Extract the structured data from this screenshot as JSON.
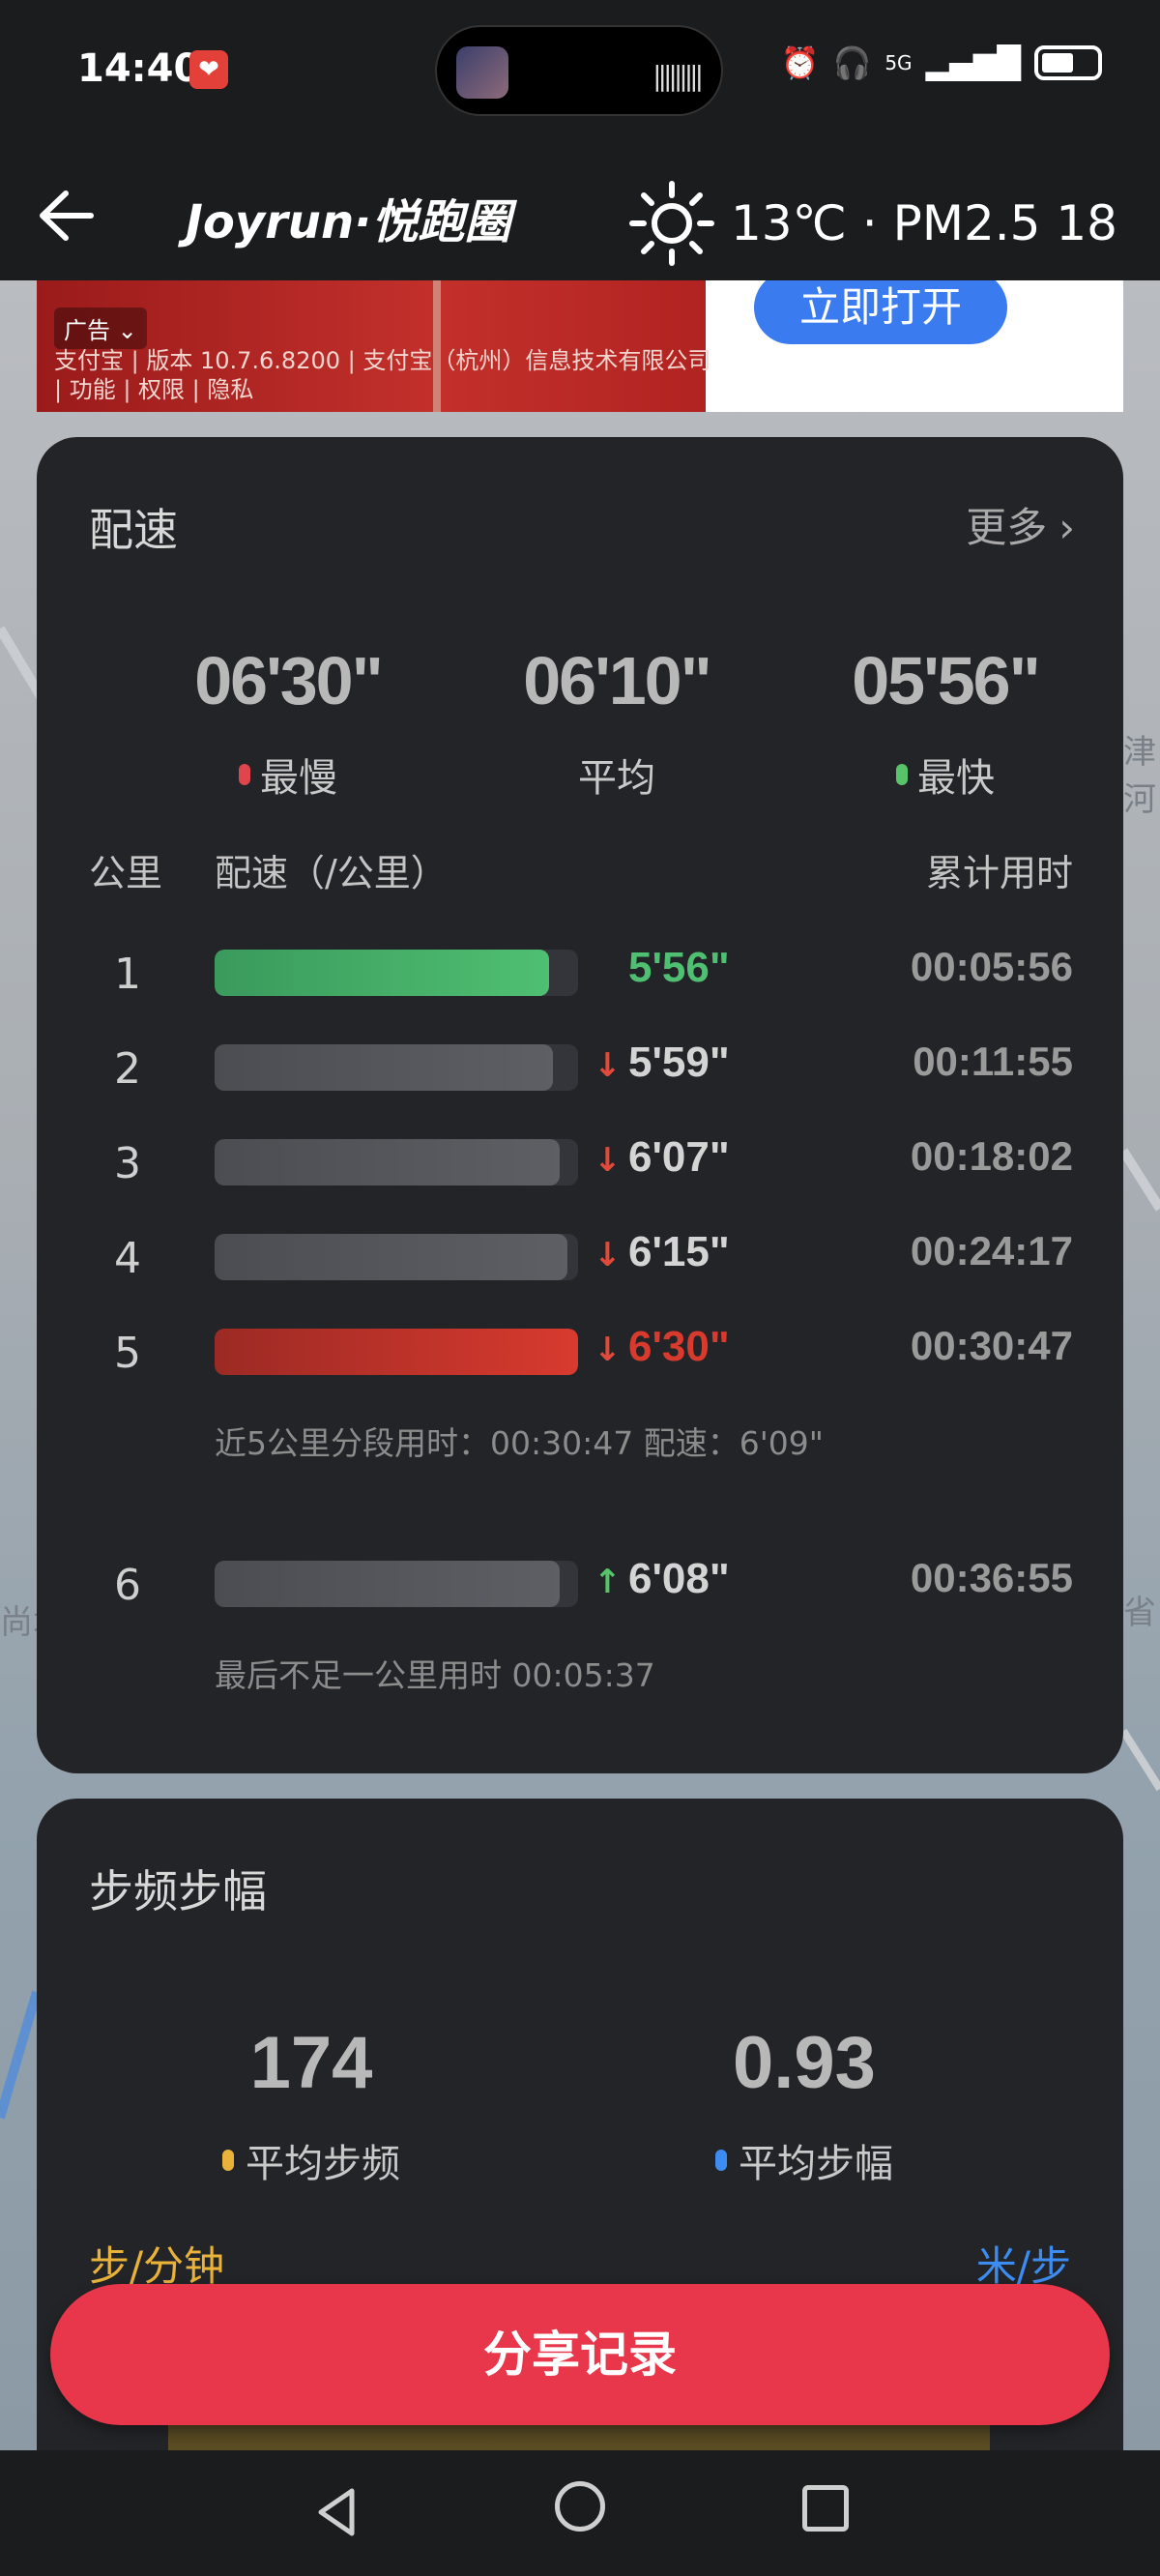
{
  "status_bar": {
    "time": "14:40",
    "network": "5G"
  },
  "header": {
    "brand": "Joyrun·悦跑圈",
    "temperature": "13℃",
    "separator": "·",
    "air_quality": "PM2.5 18"
  },
  "ad": {
    "badge": "广告",
    "text": "支付宝 | 版本 10.7.6.8200 | 支付宝（杭州）信息技术有限公司 | 功能 | 权限 | 隐私",
    "button": "立即打开"
  },
  "map": {
    "labels": [
      "津河",
      "尚城",
      "省"
    ]
  },
  "pace_card": {
    "title": "配速",
    "more": "更多",
    "summary": [
      {
        "value": "06'30\"",
        "label": "最慢",
        "dot_color": "#e0454d"
      },
      {
        "value": "06'10\"",
        "label": "平均",
        "dot_color": ""
      },
      {
        "value": "05'56\"",
        "label": "最快",
        "dot_color": "#58c46a"
      }
    ],
    "col_km": "公里",
    "col_pace": "配速（/公里）",
    "col_cum": "累计用时",
    "rows": [
      {
        "km": "1",
        "pace": "5'56\"",
        "cum": "00:05:56",
        "trend": "",
        "fill": 0.92,
        "kind": "fast"
      },
      {
        "km": "2",
        "pace": "5'59\"",
        "cum": "00:11:55",
        "trend": "down",
        "fill": 0.93,
        "kind": "normal"
      },
      {
        "km": "3",
        "pace": "6'07\"",
        "cum": "00:18:02",
        "trend": "down",
        "fill": 0.95,
        "kind": "normal"
      },
      {
        "km": "4",
        "pace": "6'15\"",
        "cum": "00:24:17",
        "trend": "down",
        "fill": 0.97,
        "kind": "normal"
      },
      {
        "km": "5",
        "pace": "6'30\"",
        "cum": "00:30:47",
        "trend": "down",
        "fill": 1.0,
        "kind": "slow"
      },
      {
        "km": "6",
        "pace": "6'08\"",
        "cum": "00:36:55",
        "trend": "up",
        "fill": 0.95,
        "kind": "normal"
      }
    ],
    "split_note": "近5公里分段用时：00:30:47   配速：6'09\"",
    "final_note": "最后不足一公里用时 00:05:37"
  },
  "cadence_card": {
    "title": "步频步幅",
    "stats": [
      {
        "value": "174",
        "label": "平均步频",
        "dot_color": "#e9b23a"
      },
      {
        "value": "0.93",
        "label": "平均步幅",
        "dot_color": "#3d8cf1"
      }
    ],
    "unit_left": "步/分钟",
    "unit_right": "米/步"
  },
  "share_button": "分享记录",
  "colors": {
    "fast": "#4fbf72",
    "slow": "#d83a2e",
    "up_arrow": "#58c46a",
    "down_arrow": "#e04a3a",
    "accent_button": "#e8364a"
  }
}
